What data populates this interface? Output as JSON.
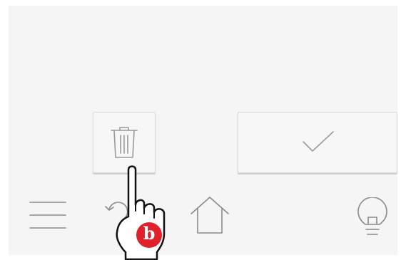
{
  "controls": {
    "delete_icon": "trash-icon",
    "confirm_icon": "checkmark-icon"
  },
  "bottom_bar": {
    "menu_icon": "hamburger-menu-icon",
    "back_icon": "back-arrow-icon",
    "home_icon": "home-icon",
    "hint_icon": "lightbulb-icon"
  },
  "gesture": {
    "icon": "pointing-hand-icon",
    "badge_label": "b",
    "badge_color": "#e0202a"
  }
}
